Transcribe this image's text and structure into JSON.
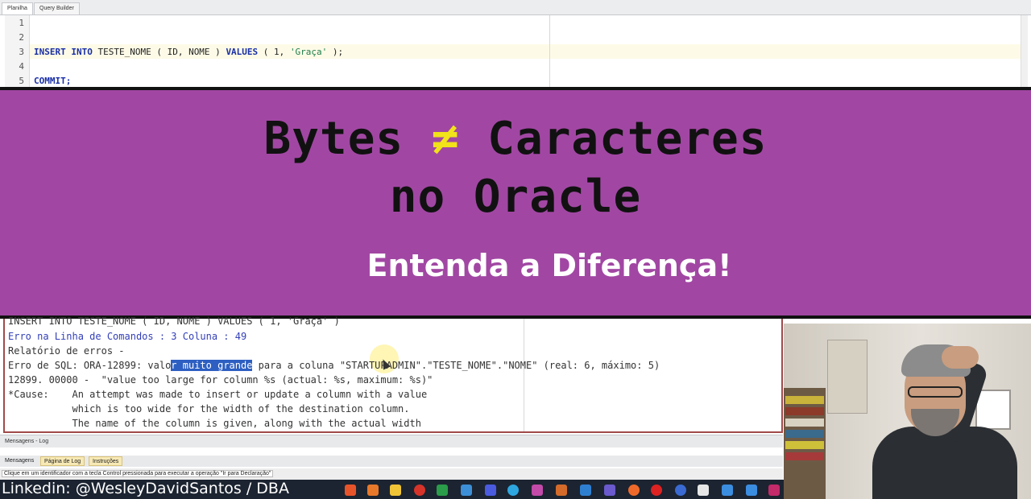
{
  "editor": {
    "tabs": [
      "Planilha",
      "Query Builder"
    ],
    "line_numbers": [
      "1",
      "2",
      "3",
      "4",
      "5"
    ],
    "line3": {
      "kw1": "INSERT INTO",
      "rest1": " TESTE_NOME ( ID, NOME ) ",
      "kw2": "VALUES",
      "rest2": " ( 1, ",
      "str": "'Graça'",
      "rest3": " );"
    },
    "line5": "COMMIT;"
  },
  "banner": {
    "title_part1": "Bytes ",
    "neq_symbol": "≠",
    "title_part2": " Caracteres",
    "title_line2": "no Oracle",
    "subtitle": "Entenda a Diferença!",
    "background_color": "#a147a3",
    "symbol_color": "#f1e21a"
  },
  "output": {
    "line0": "INSERT INTO TESTE_NOME ( ID, NOME ) VALUES ( 1, 'Graça' )",
    "line1": "Erro na Linha de Comandos : 3 Coluna : 49",
    "line2": "Relatório de erros -",
    "line3_pre": "Erro de SQL: ORA-12899: valo",
    "line3_sel": "r muito grande",
    "line3_post": " para a coluna \"STARTUPADMIN\".\"TESTE_NOME\".\"NOME\" (real: 6, máximo: 5)",
    "line4": "12899. 00000 -  \"value too large for column %s (actual: %s, maximum: %s)\"",
    "line5": "*Cause:    An attempt was made to insert or update a column with a value",
    "line6": "           which is too wide for the width of the destination column.",
    "line7": "           The name of the column is given, along with the actual width"
  },
  "log_panel": {
    "title": "Mensagens - Log",
    "tabs": [
      "Mensagens",
      "Página de Log",
      "Instruções"
    ]
  },
  "status_bar": {
    "text": "Clique em um identificador com a tecla Control pressionada para executar a operação \"Ir para Declaração\""
  },
  "taskbar": {
    "linkedin": "Linkedin: @WesleyDavidSantos / DBA"
  }
}
